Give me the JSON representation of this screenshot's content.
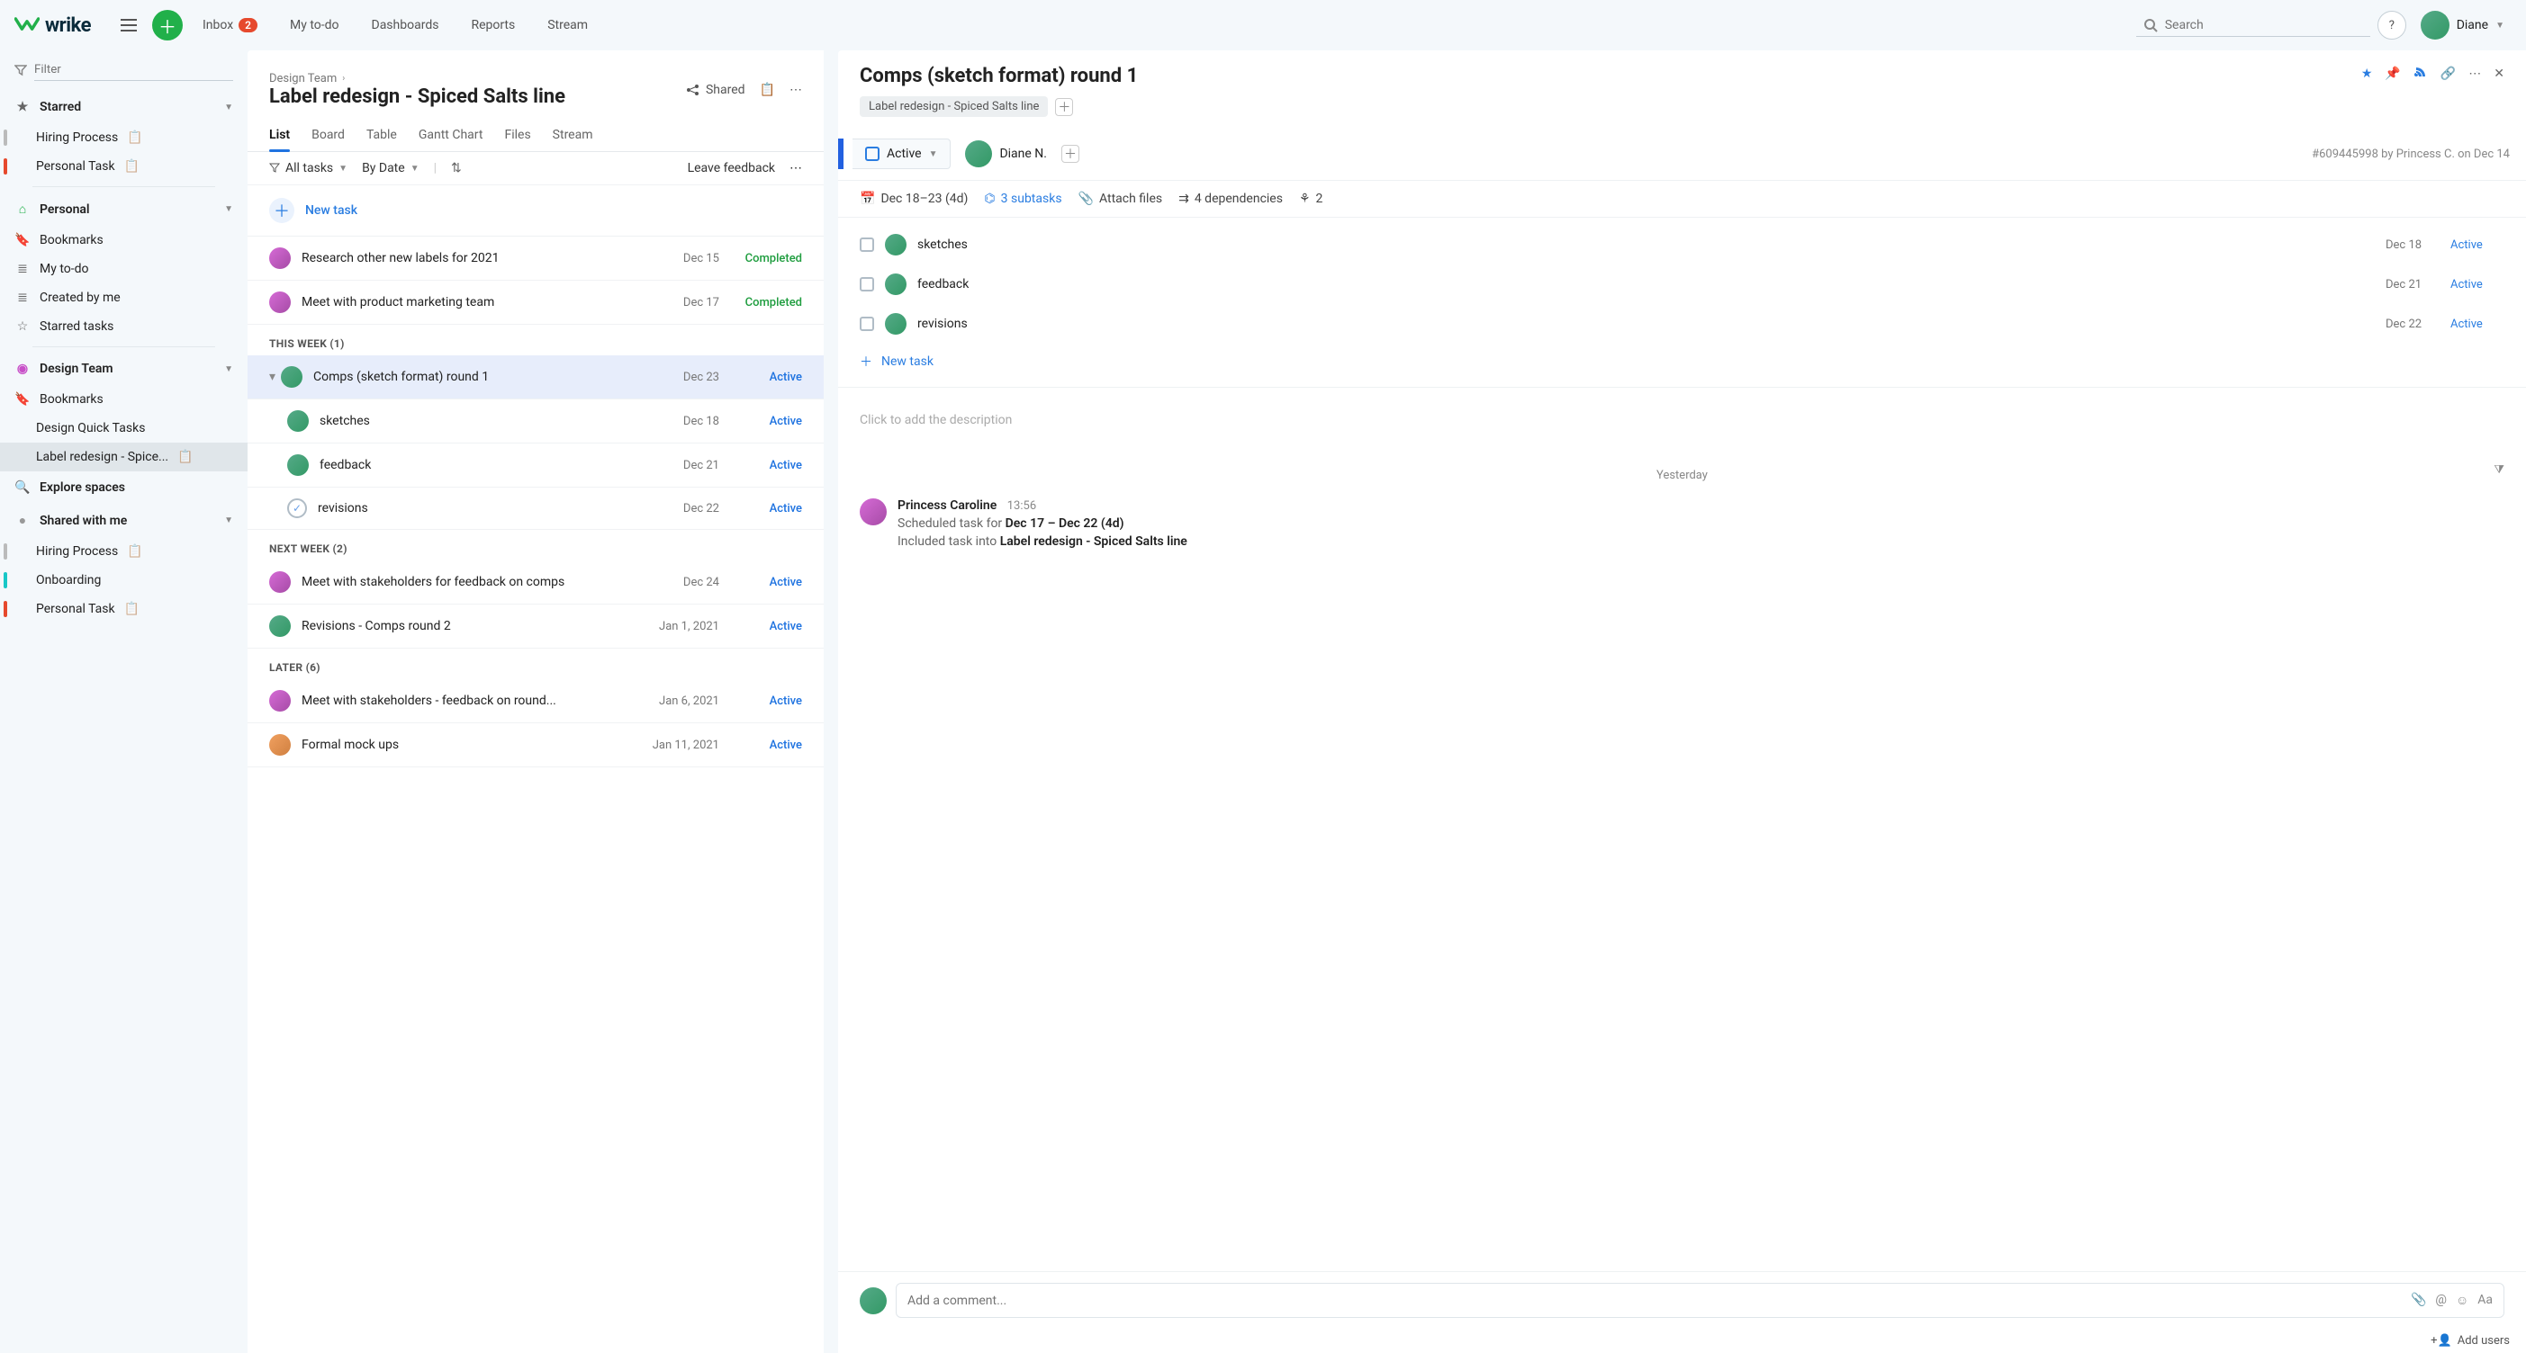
{
  "brand": {
    "name": "wrike"
  },
  "topnav": {
    "inbox_label": "Inbox",
    "inbox_badge": "2",
    "mytodo_label": "My to-do",
    "dashboards_label": "Dashboards",
    "reports_label": "Reports",
    "stream_label": "Stream",
    "search_placeholder": "Search",
    "help_label": "?",
    "user_name": "Diane"
  },
  "sidebar": {
    "filter_placeholder": "Filter",
    "starred_label": "Starred",
    "starred_items": [
      {
        "label": "Hiring Process",
        "clip": true
      },
      {
        "label": "Personal Task",
        "clip": true
      }
    ],
    "personal_label": "Personal",
    "personal_items": [
      {
        "label": "Bookmarks",
        "icon": "bookmark"
      },
      {
        "label": "My to-do",
        "icon": "list"
      },
      {
        "label": "Created by me",
        "icon": "list"
      },
      {
        "label": "Starred tasks",
        "icon": "star"
      }
    ],
    "design_team_label": "Design Team",
    "design_items": [
      {
        "label": "Bookmarks",
        "icon": "bookmark"
      },
      {
        "label": "Design Quick Tasks"
      },
      {
        "label": "Label redesign - Spice...",
        "clip": true,
        "active": true
      }
    ],
    "explore_label": "Explore spaces",
    "shared_label": "Shared with me",
    "shared_items": [
      {
        "label": "Hiring Process",
        "clip": true,
        "dot": "gray"
      },
      {
        "label": "Onboarding",
        "dot": "teal"
      },
      {
        "label": "Personal Task",
        "clip": true,
        "dot": "red"
      }
    ]
  },
  "project": {
    "crumb": "Design Team",
    "title": "Label redesign - Spiced Salts line",
    "shared_label": "Shared",
    "tabs": [
      "List",
      "Board",
      "Table",
      "Gantt Chart",
      "Files",
      "Stream"
    ],
    "active_tab": 0,
    "filters": {
      "tasks": "All tasks",
      "sort": "By Date"
    },
    "leave_feedback": "Leave feedback",
    "new_task": "New task",
    "sections": [
      {
        "header": null,
        "rows": [
          {
            "title": "Research other new labels for 2021",
            "date": "Dec 15",
            "status": "Completed",
            "avatar": "av2"
          },
          {
            "title": "Meet with product marketing team",
            "date": "Dec 17",
            "status": "Completed",
            "avatar": "av2"
          }
        ]
      },
      {
        "header": "THIS WEEK (1)",
        "rows": [
          {
            "title": "Comps (sketch format) round 1",
            "date": "Dec 23",
            "status": "Active",
            "avatar": "av1",
            "selected": true,
            "expand": true
          },
          {
            "title": "sketches",
            "date": "Dec 18",
            "status": "Active",
            "avatar": "av1",
            "sub": true
          },
          {
            "title": "feedback",
            "date": "Dec 21",
            "status": "Active",
            "avatar": "av1",
            "sub": true
          },
          {
            "title": "revisions",
            "date": "Dec 22",
            "status": "Active",
            "avatar": null,
            "sub": true,
            "check": true
          }
        ]
      },
      {
        "header": "NEXT WEEK (2)",
        "rows": [
          {
            "title": "Meet with stakeholders for feedback on comps",
            "date": "Dec 24",
            "status": "Active",
            "avatar": "av2"
          },
          {
            "title": "Revisions - Comps round 2",
            "date": "Jan 1, 2021",
            "status": "Active",
            "avatar": "av1"
          }
        ]
      },
      {
        "header": "LATER (6)",
        "rows": [
          {
            "title": "Meet with stakeholders - feedback on round...",
            "date": "Jan 6, 2021",
            "status": "Active",
            "avatar": "av2"
          },
          {
            "title": "Formal mock ups",
            "date": "Jan 11, 2021",
            "status": "Active",
            "avatar": "av3"
          }
        ]
      }
    ]
  },
  "detail": {
    "title": "Comps (sketch format) round 1",
    "tag": "Label redesign - Spiced Salts line",
    "status": "Active",
    "assignee": "Diane N.",
    "meta": "#609445998 by Princess C. on Dec 14",
    "date_range": "Dec 18–23 (4d)",
    "subtasks_link": "3 subtasks",
    "attach_label": "Attach files",
    "deps_label": "4 dependencies",
    "share_count": "2",
    "subtasks": [
      {
        "title": "sketches",
        "date": "Dec 18",
        "status": "Active"
      },
      {
        "title": "feedback",
        "date": "Dec 21",
        "status": "Active"
      },
      {
        "title": "revisions",
        "date": "Dec 22",
        "status": "Active"
      }
    ],
    "new_task_label": "New task",
    "desc_placeholder": "Click to add the description",
    "activity": {
      "day": "Yesterday",
      "author": "Princess Caroline",
      "time": "13:56",
      "line1_pre": "Scheduled task for ",
      "line1_bold": "Dec 17 – Dec 22 (4d)",
      "line2_pre": "Included task into ",
      "line2_bold": "Label redesign - Spiced Salts line"
    },
    "comment_placeholder": "Add a comment...",
    "add_users_label": "Add users"
  }
}
